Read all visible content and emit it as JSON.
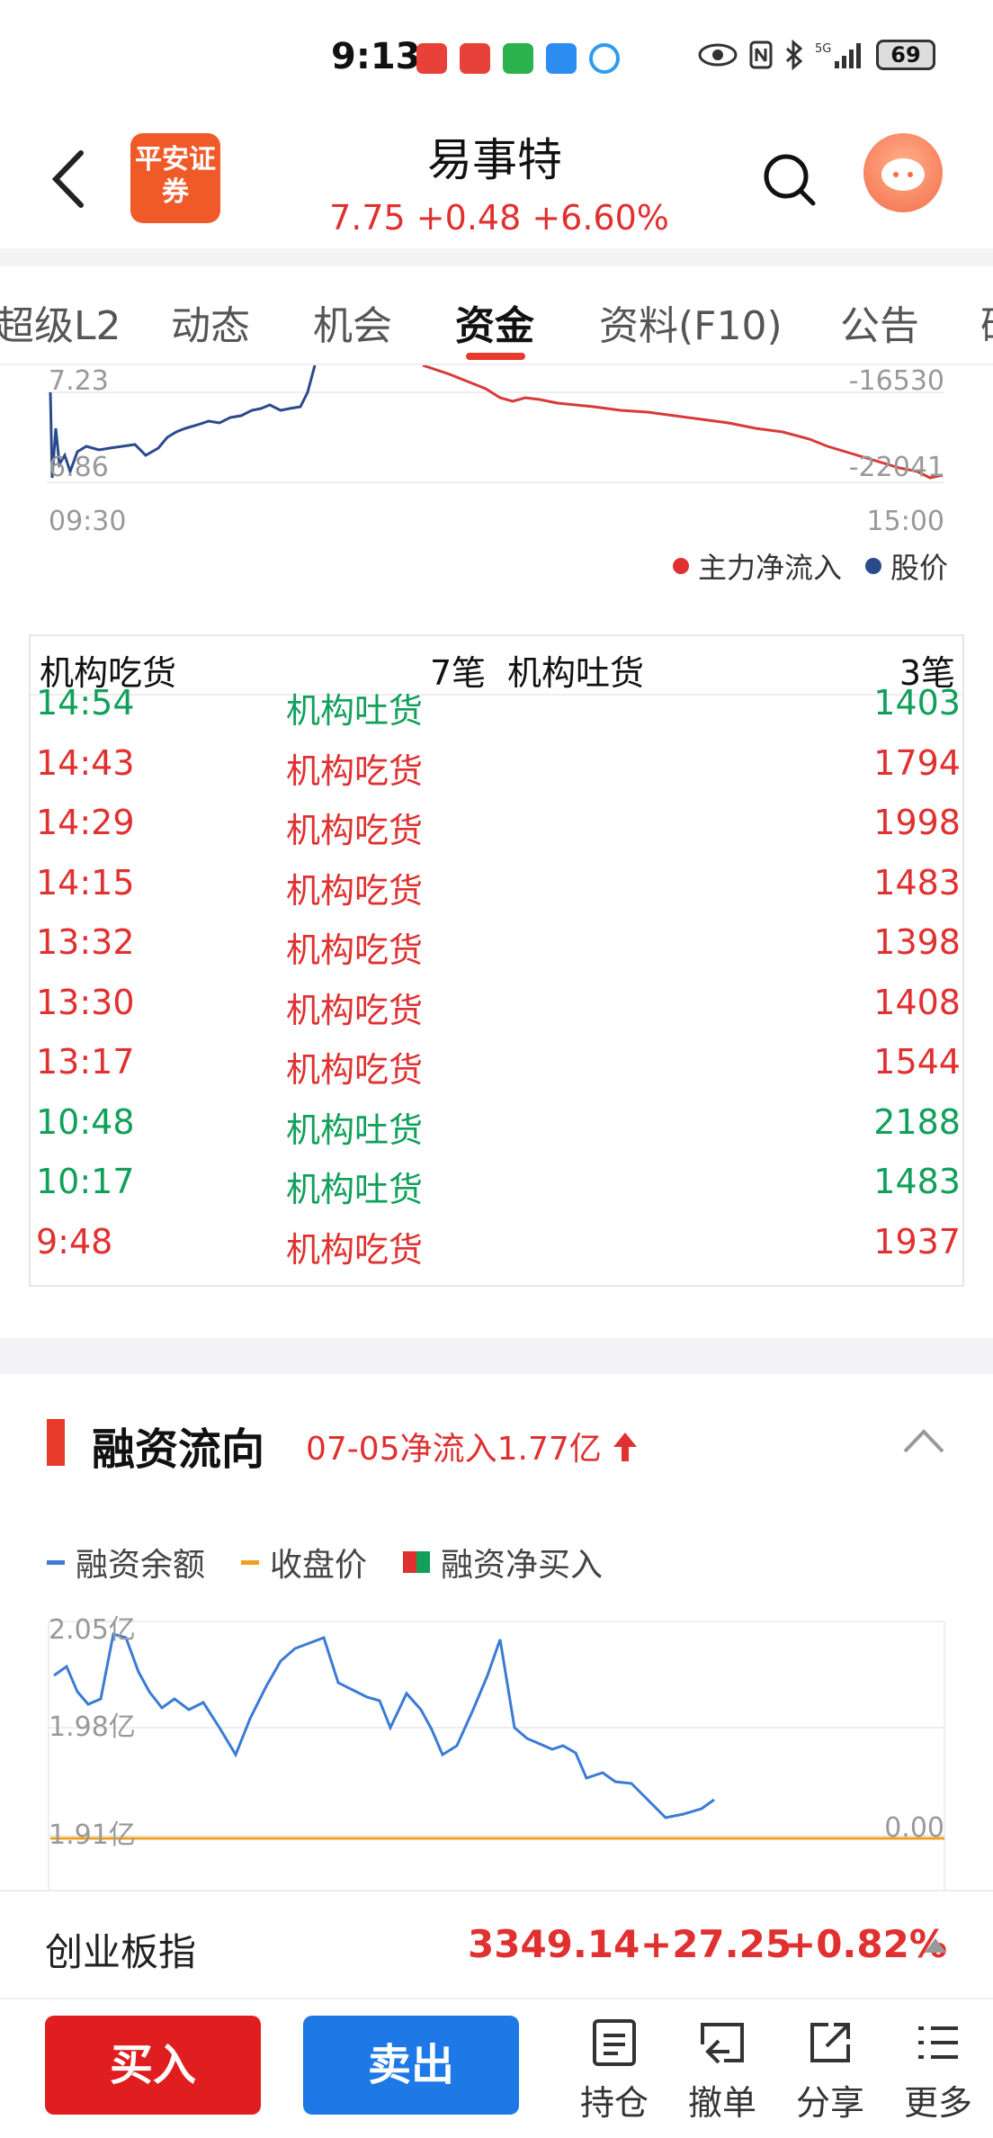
{
  "status_bar": {
    "time": "9:13",
    "battery": "69"
  },
  "header": {
    "logo_text": "平安证券",
    "title": "易事特",
    "price_line": "7.75  +0.48  +6.60%"
  },
  "tabs": [
    "超级L2",
    "动态",
    "机会",
    "资金",
    "资料(F10)",
    "公告",
    "研"
  ],
  "active_tab": "资金",
  "flow_chart": {
    "y_top_left": "7.23",
    "y_bottom_left": "6.86",
    "y_top_right": "-16530",
    "y_bottom_right": "-22041",
    "x_start": "09:30",
    "x_end": "15:00",
    "legend_main": "主力净流入",
    "legend_price": "股价"
  },
  "institution_table": {
    "buy_label": "机构吃货",
    "buy_count": "7笔",
    "sell_label": "机构吐货",
    "sell_count": "3笔",
    "rows": [
      {
        "time": "14:54",
        "type": "机构吐货",
        "volume": "1403",
        "color": "green"
      },
      {
        "time": "14:43",
        "type": "机构吃货",
        "volume": "1794",
        "color": "red"
      },
      {
        "time": "14:29",
        "type": "机构吃货",
        "volume": "1998",
        "color": "red"
      },
      {
        "time": "14:15",
        "type": "机构吃货",
        "volume": "1483",
        "color": "red"
      },
      {
        "time": "13:32",
        "type": "机构吃货",
        "volume": "1398",
        "color": "red"
      },
      {
        "time": "13:30",
        "type": "机构吃货",
        "volume": "1408",
        "color": "red"
      },
      {
        "time": "13:17",
        "type": "机构吃货",
        "volume": "1544",
        "color": "red"
      },
      {
        "time": "10:48",
        "type": "机构吐货",
        "volume": "2188",
        "color": "green"
      },
      {
        "time": "10:17",
        "type": "机构吐货",
        "volume": "1483",
        "color": "green"
      },
      {
        "time": "9:48",
        "type": "机构吃货",
        "volume": "1937",
        "color": "red"
      }
    ]
  },
  "financing": {
    "title": "融资流向",
    "subtitle": "07-05净流入1.77亿",
    "legend": {
      "balance": "融资余额",
      "close": "收盘价",
      "net_buy": "融资净买入"
    },
    "y_labels": [
      "2.05亿",
      "1.98亿",
      "1.91亿"
    ],
    "right_label": "0.00"
  },
  "index_bar": {
    "name": "创业板指",
    "value": "3349.14",
    "change": "+27.25",
    "percent": "+0.82%"
  },
  "bottom_bar": {
    "buy": "买入",
    "sell": "卖出",
    "tools": [
      "持仓",
      "撤单",
      "分享",
      "更多"
    ]
  },
  "colors": {
    "up": "#e03030",
    "down": "#10a05a",
    "accent": "#e83a2a",
    "sell_blue": "#1e78e6"
  }
}
